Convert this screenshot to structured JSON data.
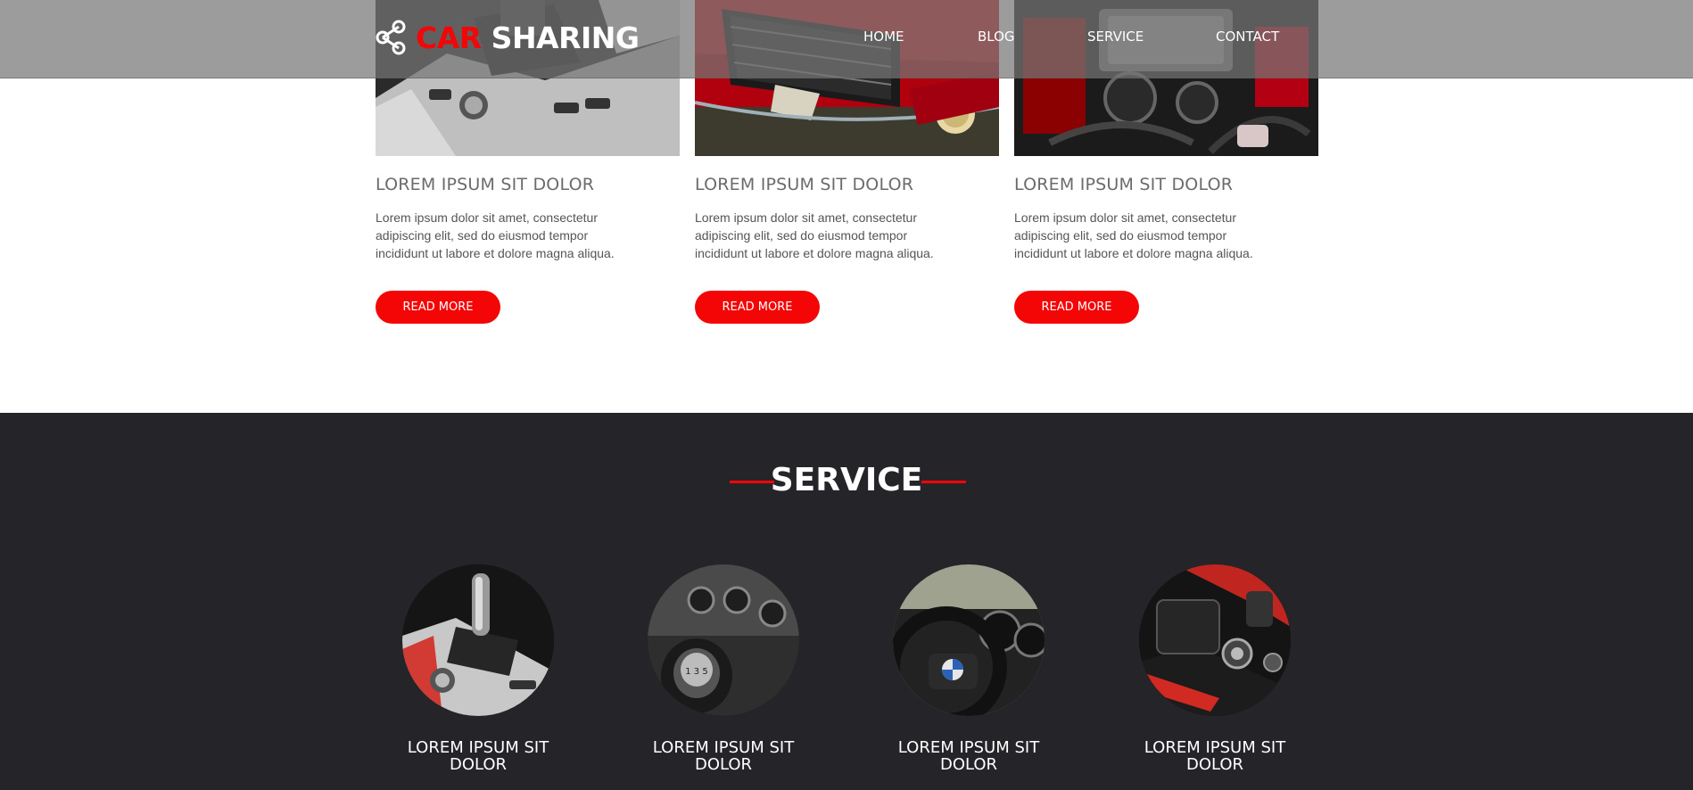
{
  "brand": {
    "word1": "CAR",
    "word2": "SHARING",
    "accent_color": "#f40606"
  },
  "nav": {
    "items": [
      "HOME",
      "BLOG",
      "SERVICE",
      "CONTACT"
    ]
  },
  "blog": {
    "cards": [
      {
        "title": "LOREM IPSUM SIT DOLOR",
        "text": "Lorem ipsum dolor sit amet, consectetur adipiscing elit, sed do eiusmod tempor incididunt ut labore et dolore magna aliqua.",
        "button": "READ MORE",
        "image_subject": "gear-shifter-console"
      },
      {
        "title": "LOREM IPSUM SIT DOLOR",
        "text": "Lorem ipsum dolor sit amet, consectetur adipiscing elit, sed do eiusmod tempor incididunt ut labore et dolore magna aliqua.",
        "button": "READ MORE",
        "image_subject": "red-car-front"
      },
      {
        "title": "LOREM IPSUM SIT DOLOR",
        "text": "Lorem ipsum dolor sit amet, consectetur adipiscing elit, sed do eiusmod tempor incididunt ut labore et dolore magna aliqua.",
        "button": "READ MORE",
        "image_subject": "engine-bay"
      }
    ]
  },
  "service": {
    "heading": "SERVICE",
    "items": [
      {
        "title": "LOREM IPSUM SIT DOLOR",
        "image_subject": "automatic-gear-shifter"
      },
      {
        "title": "LOREM IPSUM SIT DOLOR",
        "image_subject": "manual-gear-knob"
      },
      {
        "title": "LOREM IPSUM SIT DOLOR",
        "image_subject": "steering-wheel"
      },
      {
        "title": "LOREM IPSUM SIT DOLOR",
        "image_subject": "center-console"
      }
    ]
  }
}
